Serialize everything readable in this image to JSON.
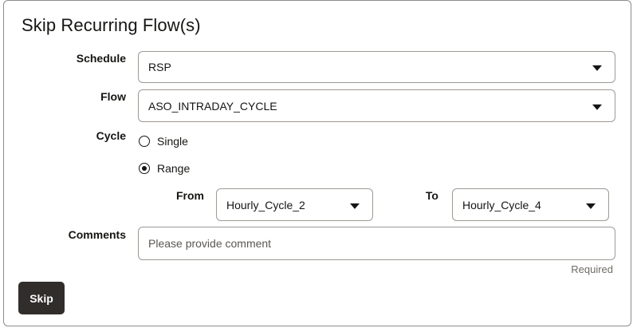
{
  "dialog": {
    "title": "Skip Recurring Flow(s)"
  },
  "form": {
    "schedule": {
      "label": "Schedule",
      "value": "RSP"
    },
    "flow": {
      "label": "Flow",
      "value": "ASO_INTRADAY_CYCLE"
    },
    "cycle": {
      "label": "Cycle",
      "options": [
        {
          "label": "Single",
          "selected": false
        },
        {
          "label": "Range",
          "selected": true
        }
      ],
      "from": {
        "label": "From",
        "value": "Hourly_Cycle_2"
      },
      "to": {
        "label": "To",
        "value": "Hourly_Cycle_4"
      }
    },
    "comments": {
      "label": "Comments",
      "value": "",
      "placeholder": "Please provide comment",
      "helper": "Required"
    }
  },
  "actions": {
    "skip_label": "Skip"
  },
  "icons": {
    "dropdown": "chevron-down-icon",
    "radio": "radio-icon"
  }
}
